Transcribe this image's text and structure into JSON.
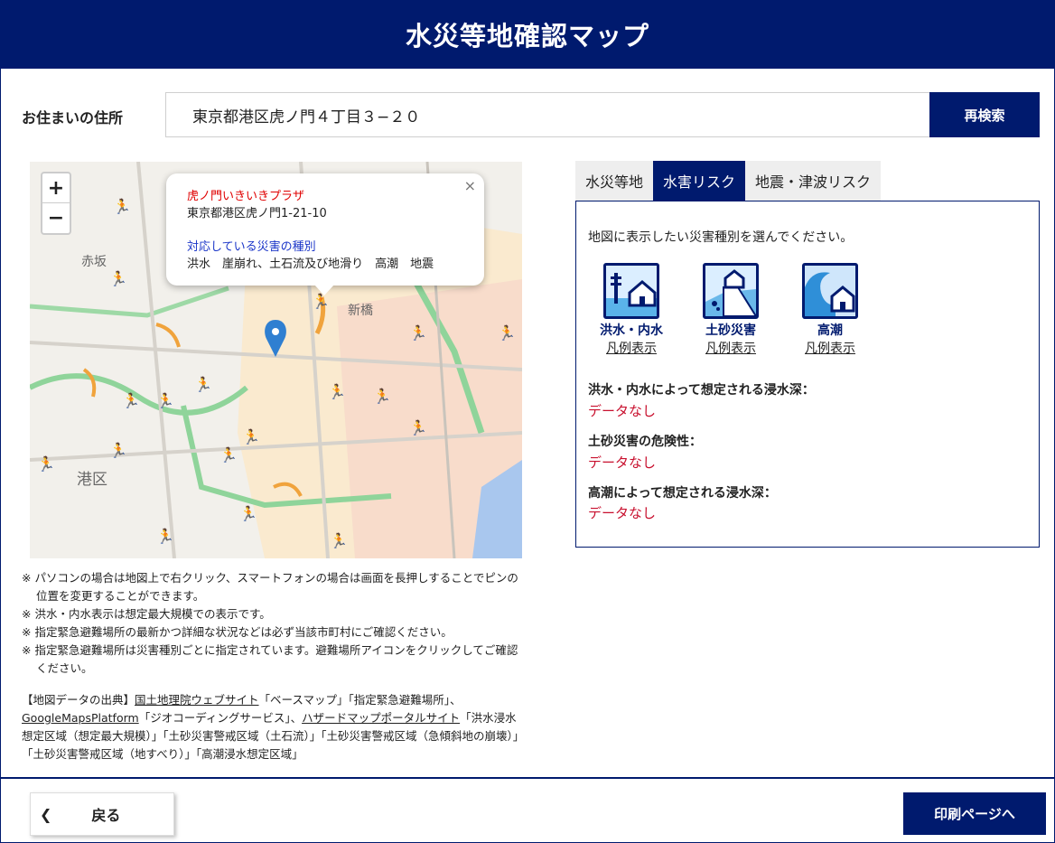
{
  "header": {
    "title": "水災等地確認マップ"
  },
  "address": {
    "label": "お住まいの住所",
    "value": "東京都港区虎ノ門４丁目３−２０",
    "search_label": "再検索"
  },
  "map": {
    "zoom_in": "+",
    "zoom_out": "−",
    "labels": {
      "akasaka": "赤坂",
      "shinbashi": "新橋",
      "minato": "港区"
    },
    "popup": {
      "close": "×",
      "place_name": "虎ノ門いきいきプラザ",
      "place_address": "東京都港区虎ノ門1-21-10",
      "disaster_title": "対応している災害の種別",
      "disaster_types": "洪水　崖崩れ、土石流及び地滑り　高潮　地震"
    }
  },
  "notes": [
    "※ パソコンの場合は地図上で右クリック、スマートフォンの場合は画面を長押しすることでピンの位置を変更することができます。",
    "※ 洪水・内水表示は想定最大規模での表示です。",
    "※ 指定緊急避難場所の最新かつ詳細な状況などは必ず当該市町村にご確認ください。",
    "※ 指定緊急避難場所は災害種別ごとに指定されています。避難場所アイコンをクリックしてご確認ください。"
  ],
  "source": {
    "prefix": "【地図データの出典】",
    "link_gsi": "国土地理院ウェブサイト",
    "text_1": "「ベースマップ」「指定緊急避難場所」、",
    "link_google": "GoogleMapsPlatform",
    "text_2": "「ジオコーディングサービス」、",
    "link_hazard": "ハザードマップポータルサイト",
    "text_3": "「洪水浸水想定区域（想定最大規模）」「土砂災害警戒区域（土石流）」「土砂災害警戒区域（急傾斜地の崩壊）」「土砂災害警戒区域（地すべり）」「高潮浸水想定区域」"
  },
  "tabs": [
    {
      "label": "水災等地",
      "active": false
    },
    {
      "label": "水害リスク",
      "active": true
    },
    {
      "label": "地震・津波リスク",
      "active": false
    }
  ],
  "risk_panel": {
    "instruction": "地図に表示したい災害種別を選んでください。",
    "hazards": [
      {
        "name": "洪水・内水",
        "legend": "凡例表示",
        "icon": "flood-icon"
      },
      {
        "name": "土砂災害",
        "legend": "凡例表示",
        "icon": "landslide-icon"
      },
      {
        "name": "高潮",
        "legend": "凡例表示",
        "icon": "storm-surge-icon"
      }
    ],
    "results": [
      {
        "label": "洪水・内水によって想定される浸水深：",
        "value": "データなし"
      },
      {
        "label": "土砂災害の危険性：",
        "value": "データなし"
      },
      {
        "label": "高潮によって想定される浸水深：",
        "value": "データなし"
      }
    ]
  },
  "footer": {
    "back_label": "戻る",
    "print_label": "印刷ページへ"
  },
  "colors": {
    "brand": "#001a6e",
    "alert": "#c8102e",
    "popup_name": "#e00000",
    "popup_title": "#1a35c8"
  }
}
